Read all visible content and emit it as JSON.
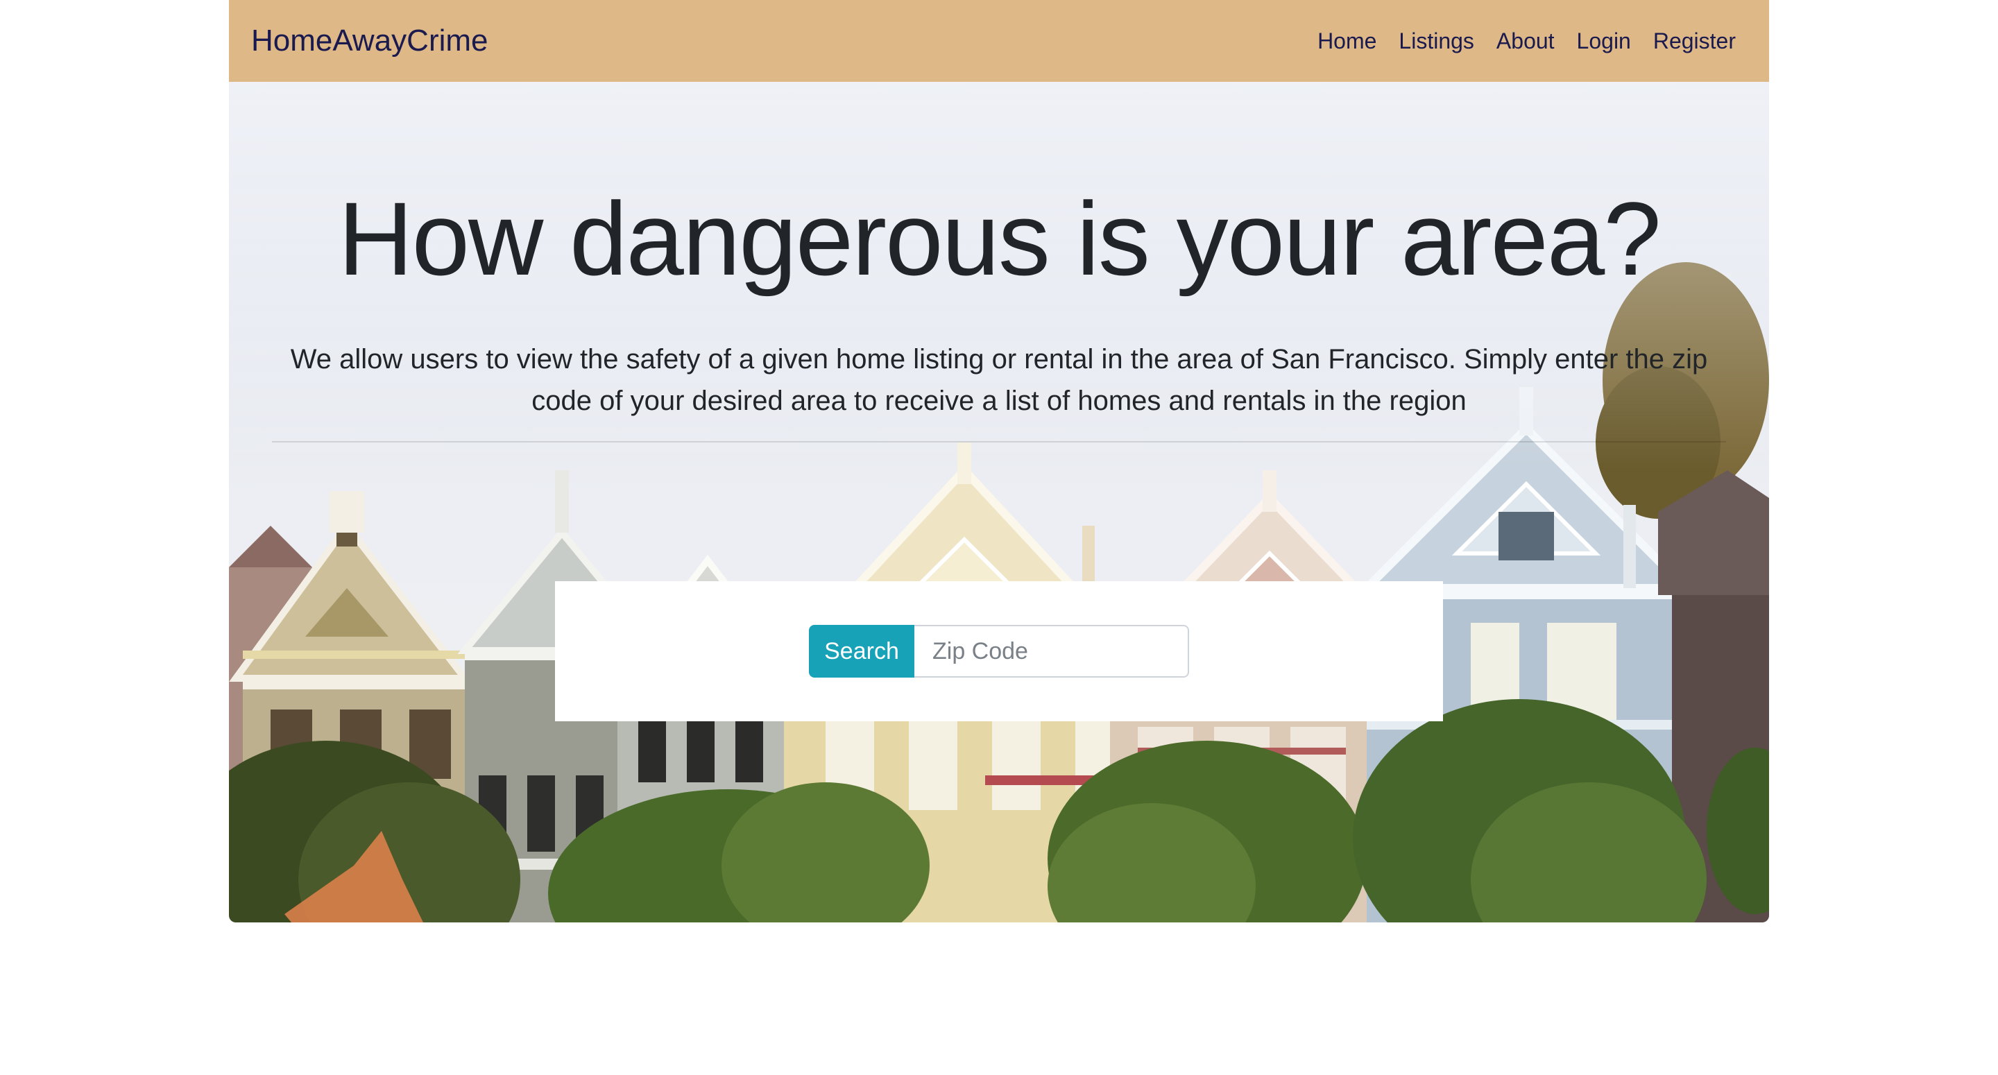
{
  "navbar": {
    "brand": "HomeAwayCrime",
    "links": [
      "Home",
      "Listings",
      "About",
      "Login",
      "Register"
    ]
  },
  "hero": {
    "title": "How dangerous is your area?",
    "lead": "We allow users to view the safety of a given home listing or rental in the area of San Francisco. Simply enter the zip code of your desired area to receive a list of homes and rentals in the region",
    "background_image": "painted-ladies-houses"
  },
  "search": {
    "button_label": "Search",
    "placeholder": "Zip Code",
    "value": ""
  },
  "colors": {
    "navbar_bg": "#deb887",
    "nav_text": "#1a1a4e",
    "button_bg": "#17a2b8",
    "heading_text": "#212529"
  }
}
